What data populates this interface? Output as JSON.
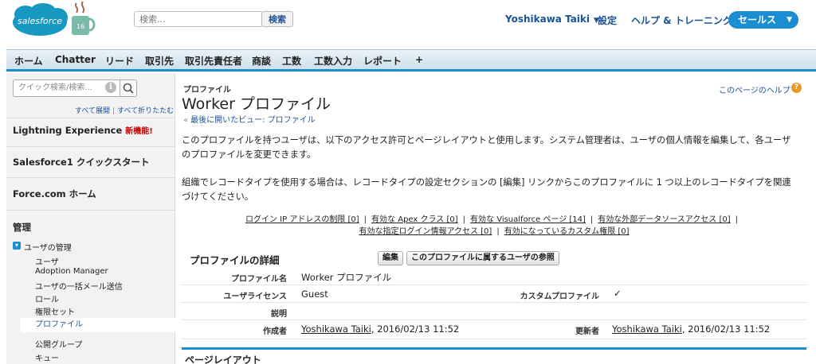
{
  "header": {
    "logo_text": "salesforce",
    "mug_text": "16",
    "search_placeholder": "検索...",
    "search_button": "検索",
    "user_name": "Yoshikawa Taiki",
    "setup": "設定",
    "help": "ヘルプ & トレーニング",
    "app_menu": "セールス"
  },
  "tabs": [
    "ホーム",
    "Chatter",
    "リード",
    "取引先",
    "取引先責任者",
    "商談",
    "工数",
    "工数入力",
    "レポート",
    "+"
  ],
  "sidebar": {
    "quick_search_placeholder": "クイック検索/検索...",
    "expand_all": "すべて展開",
    "collapse_all": "すべて折りたたむ",
    "lightning": "Lightning Experience",
    "new_badge": "新機能!",
    "quickstart": "Salesforce1 クイックスタート",
    "forcecom": "Force.com ホーム",
    "admin": "管理",
    "user_mgmt": "ユーザの管理",
    "items": [
      "ユーザ",
      "Adoption Manager",
      "ユーザの一括メール送信",
      "ロール",
      "権限セット",
      "プロファイル",
      "公開グループ",
      "キュー"
    ]
  },
  "main": {
    "type_label": "プロファイル",
    "title": "Worker プロファイル",
    "back_link": "最後に開いたビュー: プロファイル",
    "help_link": "このページのヘルプ",
    "desc1_line1": "このプロファイルを持つユーザは、以下のアクセス許可とページレイアウトと使用します。システム管理者は、ユーザの個人情報を編集して、各ユーザ",
    "desc1_line2": "のプロファイルを変更できます。",
    "desc2_line1": "組織でレコードタイプを使用する場合は、レコードタイプの設定セクションの [編集] リンクからこのプロファイルに 1 つ以上のレコードタイプを関連",
    "desc2_line2": "づけてください。",
    "links": [
      "ログイン IP アドレスの制限 [0]",
      "有効な Apex クラス [0]",
      "有効な Visualforce ページ [14]",
      "有効な外部データソースアクセス [0]",
      "有効な指定ログイン情報アクセス [0]",
      "有効になっているカスタム権限 [0]"
    ],
    "section_title": "プロファイルの詳細",
    "edit_button": "編集",
    "view_users_button": "このプロファイルに属するユーザの参照",
    "details": {
      "name_label": "プロファイル名",
      "name_value": "Worker プロファイル",
      "license_label": "ユーザライセンス",
      "license_value": "Guest",
      "custom_label": "カスタムプロファイル",
      "custom_value": "✓",
      "desc_label": "説明",
      "created_label": "作成者",
      "created_user": "Yoshikawa Taiki",
      "created_date": ", 2016/02/13 11:52",
      "modified_label": "更新者",
      "modified_user": "Yoshikawa Taiki",
      "modified_date": ", 2016/02/13 11:52"
    },
    "layout_title": "ページレイアウト"
  }
}
